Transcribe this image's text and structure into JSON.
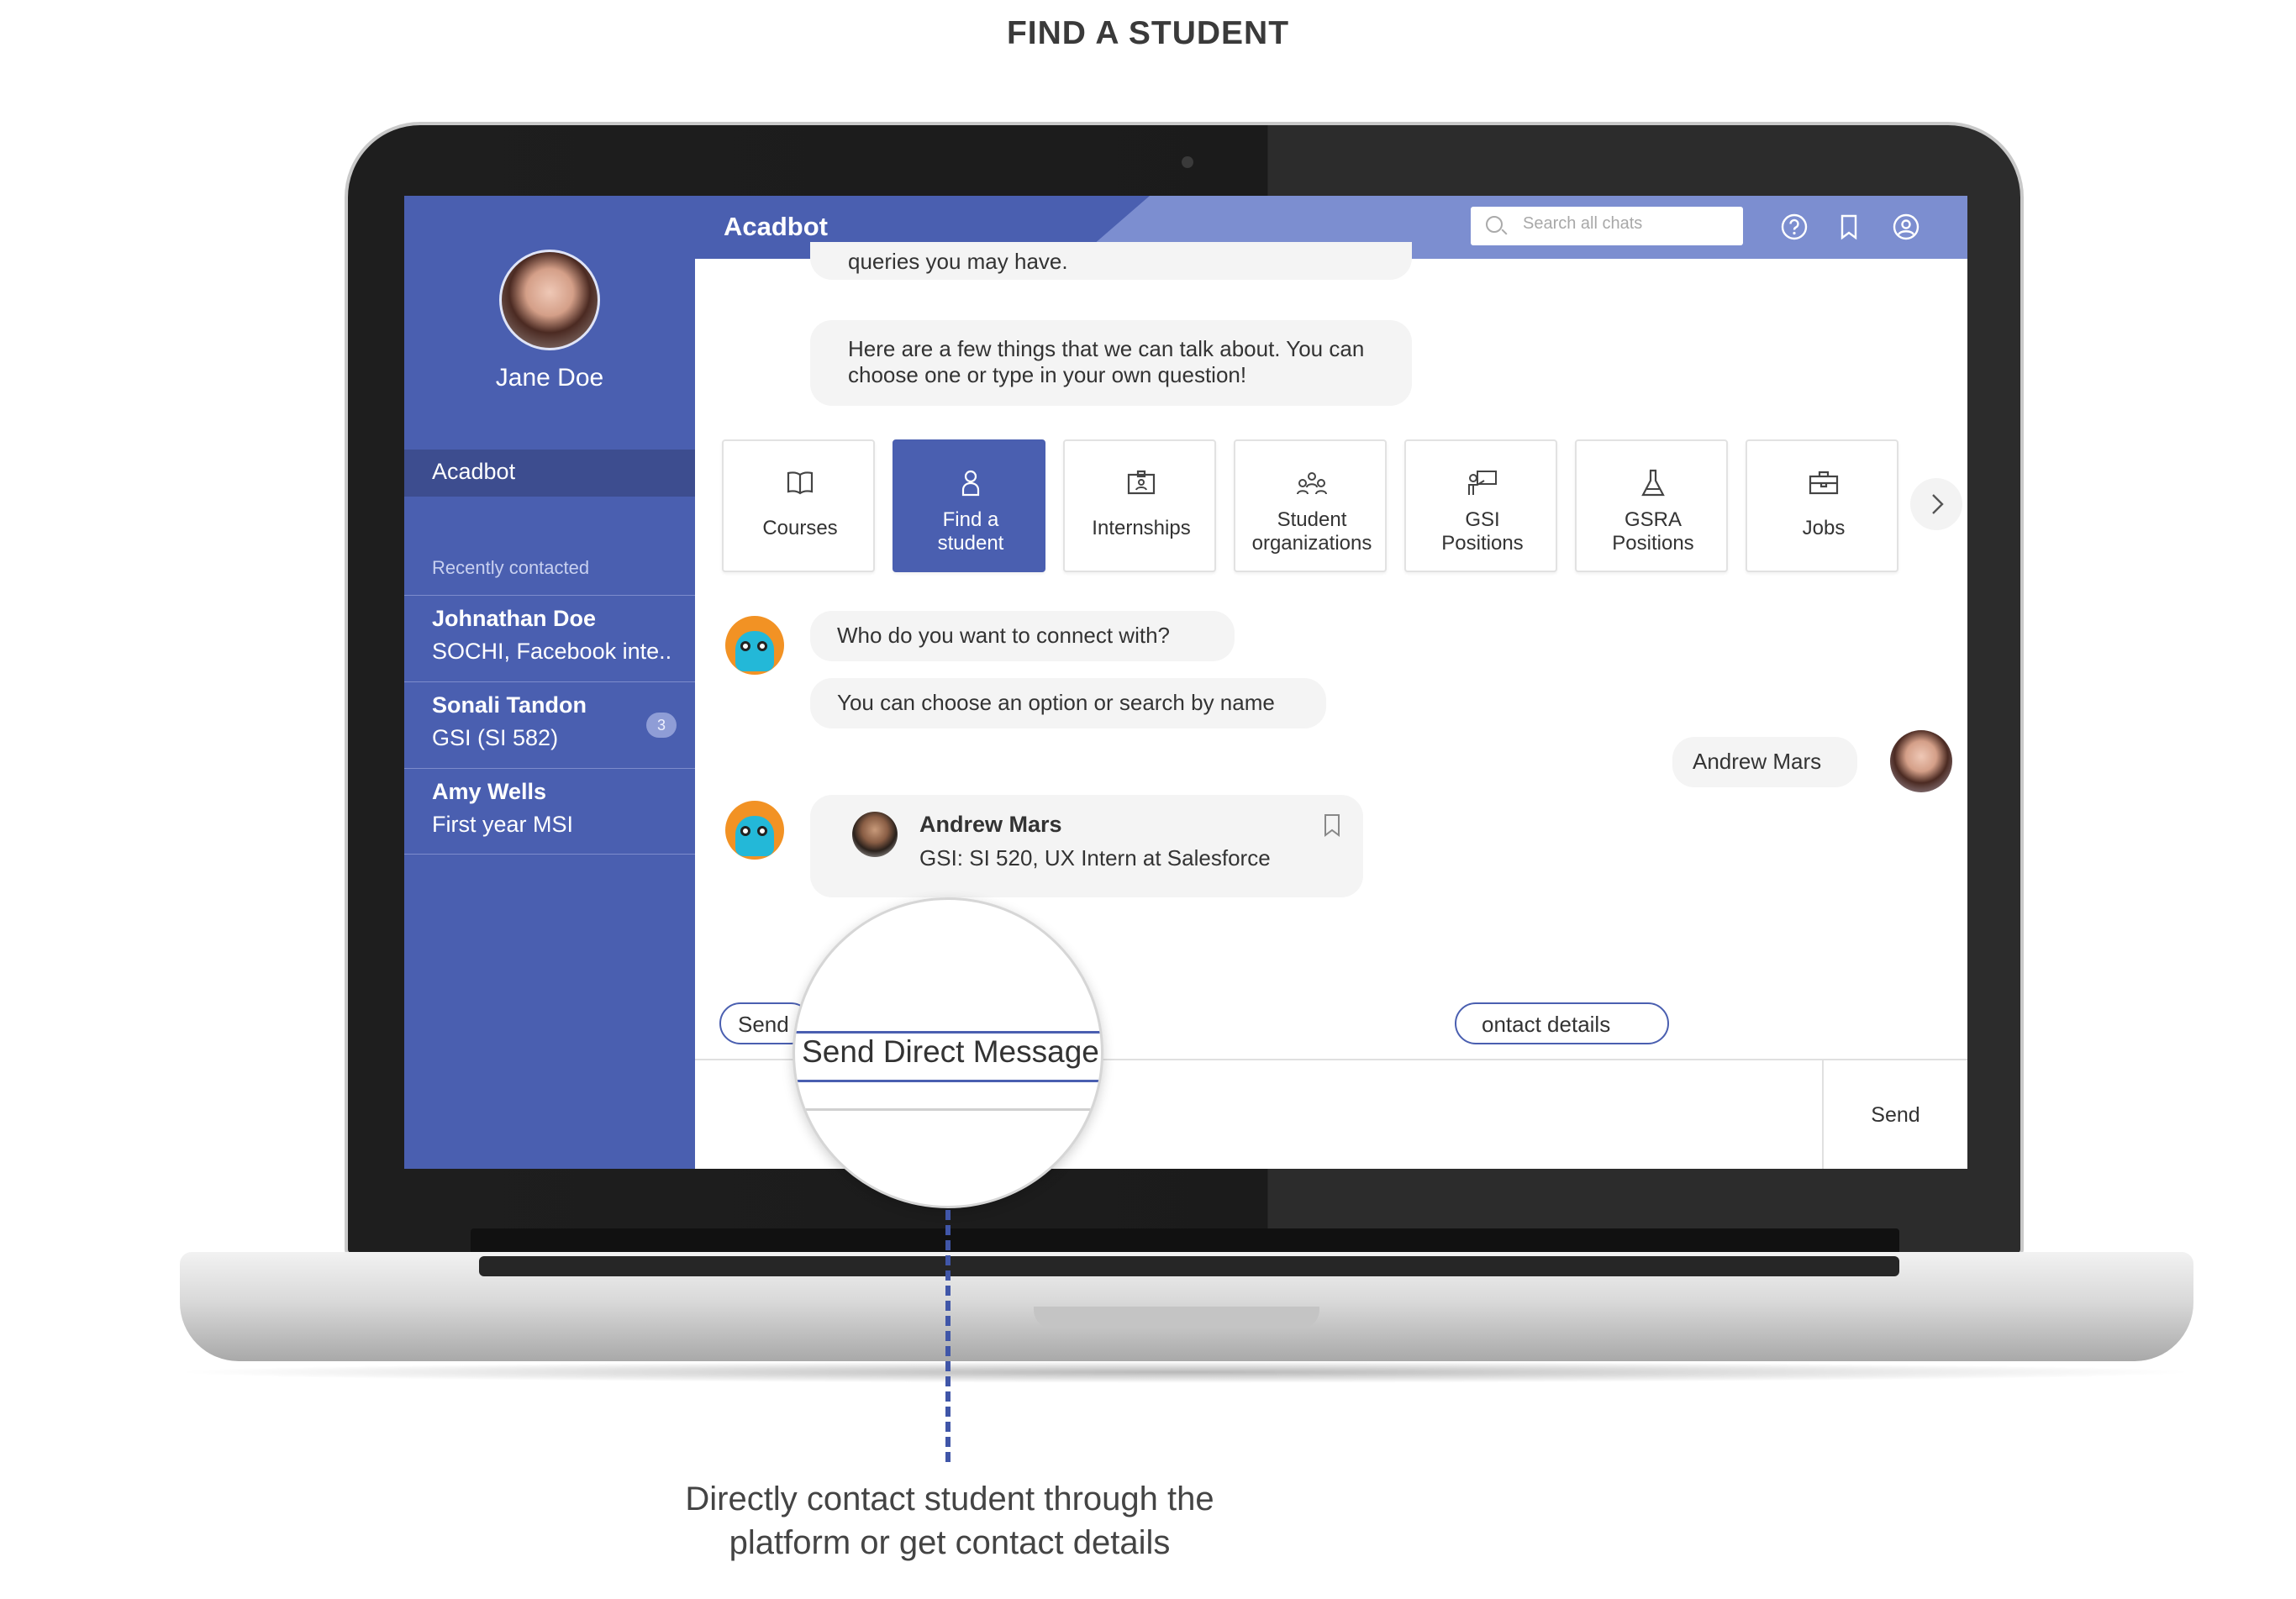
{
  "heading": "FIND A STUDENT",
  "caption": "Directly contact student through the platform or get contact details",
  "colors": {
    "accent": "#4a5fb0",
    "accent_light": "#7c8ed0",
    "sidebar_active": "#3d4d8f"
  },
  "sidebar": {
    "user_name": "Jane Doe",
    "nav_active": "Acadbot",
    "recent_label": "Recently contacted",
    "contacts": [
      {
        "name": "Johnathan Doe",
        "sub": "SOCHI, Facebook inte.."
      },
      {
        "name": "Sonali Tandon",
        "sub": "GSI (SI 582)",
        "badge": "3"
      },
      {
        "name": "Amy Wells",
        "sub": "First year MSI"
      }
    ]
  },
  "header": {
    "title": "Acadbot",
    "search_placeholder": "Search all chats",
    "icons": [
      "help-icon",
      "bookmark-icon",
      "profile-icon"
    ]
  },
  "chat": {
    "msg1": "queries you may have.",
    "msg2": "Here are a few things that we can talk about. You can choose one or type in your own question!",
    "options": [
      {
        "label": "Courses",
        "icon": "book-icon"
      },
      {
        "label": "Find a student",
        "icon": "person-icon",
        "active": true
      },
      {
        "label": "Internships",
        "icon": "id-badge-icon"
      },
      {
        "label": "Student organizations",
        "icon": "group-icon"
      },
      {
        "label": "GSI Positions",
        "icon": "presenter-icon"
      },
      {
        "label": "GSRA Positions",
        "icon": "flask-icon"
      },
      {
        "label": "Jobs",
        "icon": "briefcase-icon"
      }
    ],
    "msg3": "Who do you want to connect with?",
    "msg4": "You can choose an option or search by name",
    "user_reply": "Andrew Mars",
    "result": {
      "name": "Andrew Mars",
      "sub": "GSI: SI 520, UX Intern at Salesforce"
    },
    "actions": {
      "send_partial": "Send",
      "contact_partial": "ontact details"
    },
    "send_button": "Send"
  },
  "magnifier": {
    "text": "Send Direct Message"
  }
}
